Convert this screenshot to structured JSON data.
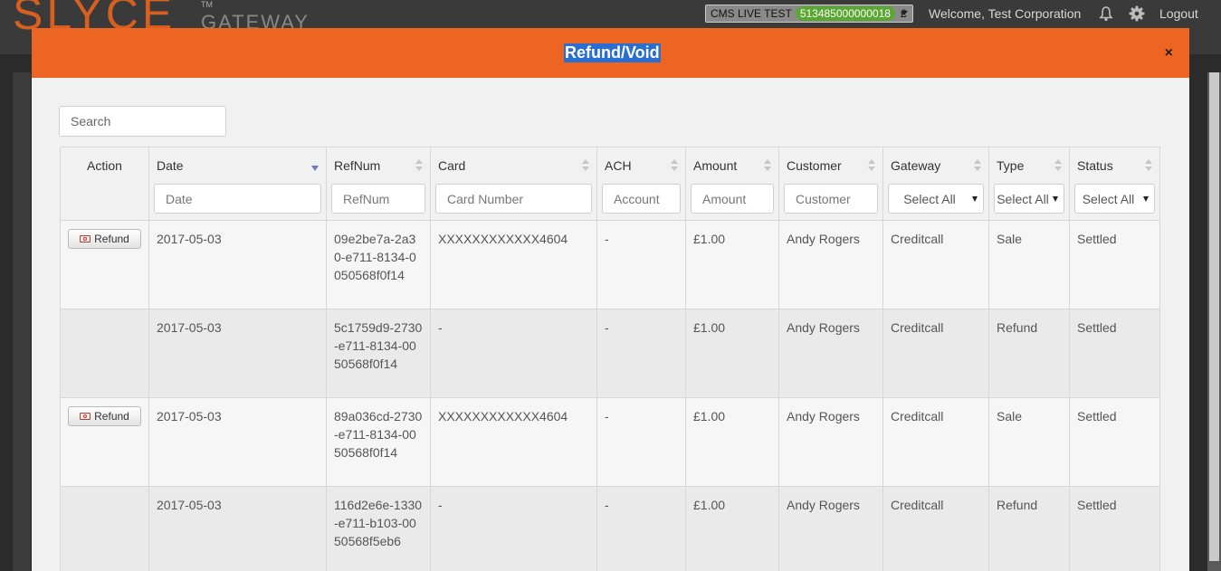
{
  "topbar": {
    "logo": "SLYCE",
    "logo_sub": "GATEWAY",
    "logo_tm": "TM",
    "account": {
      "name": "CMS LIVE TEST",
      "id": "513485000000018",
      "currency": "£"
    },
    "welcome": "Welcome, Test Corporation",
    "logout": "Logout",
    "icons": [
      "bell-icon",
      "gear-icon"
    ]
  },
  "modal": {
    "title": "Refund/Void",
    "close": "×",
    "search": {
      "placeholder": "Search",
      "value": ""
    }
  },
  "table": {
    "columns": [
      {
        "label": "Action"
      },
      {
        "label": "Date",
        "filter_placeholder": "Date",
        "sort": "desc"
      },
      {
        "label": "RefNum",
        "filter_placeholder": "RefNum"
      },
      {
        "label": "Card",
        "filter_placeholder": "Card Number"
      },
      {
        "label": "ACH",
        "filter_placeholder": "Account"
      },
      {
        "label": "Amount",
        "filter_placeholder": "Amount"
      },
      {
        "label": "Customer",
        "filter_placeholder": "Customer"
      },
      {
        "label": "Gateway",
        "filter_select": "Select All"
      },
      {
        "label": "Type",
        "filter_select": "Select All"
      },
      {
        "label": "Status",
        "filter_select": "Select All"
      }
    ],
    "refund_label": "Refund",
    "rows": [
      {
        "action": true,
        "date": "2017-05-03",
        "refnum": "09e2be7a-2a30-e711-8134-0050568f0f14",
        "card": "XXXXXXXXXXXX4604",
        "ach": "-",
        "amount": "£1.00",
        "customer": "Andy Rogers",
        "gateway": "Creditcall",
        "type": "Sale",
        "status": "Settled"
      },
      {
        "action": false,
        "date": "2017-05-03",
        "refnum": "5c1759d9-2730-e711-8134-0050568f0f14",
        "card": "-",
        "ach": "-",
        "amount": "£1.00",
        "customer": "Andy Rogers",
        "gateway": "Creditcall",
        "type": "Refund",
        "status": "Settled"
      },
      {
        "action": true,
        "date": "2017-05-03",
        "refnum": "89a036cd-2730-e711-8134-0050568f0f14",
        "card": "XXXXXXXXXXXX4604",
        "ach": "-",
        "amount": "£1.00",
        "customer": "Andy Rogers",
        "gateway": "Creditcall",
        "type": "Sale",
        "status": "Settled"
      },
      {
        "action": false,
        "date": "2017-05-03",
        "refnum": "116d2e6e-1330-e711-b103-0050568f5eb6",
        "card": "-",
        "ach": "-",
        "amount": "£1.00",
        "customer": "Andy Rogers",
        "gateway": "Creditcall",
        "type": "Refund",
        "status": "Settled"
      }
    ]
  },
  "colors": {
    "header": "#ec6523",
    "accent_badge": "#5aa832",
    "sort_active": "#6c78c9"
  }
}
